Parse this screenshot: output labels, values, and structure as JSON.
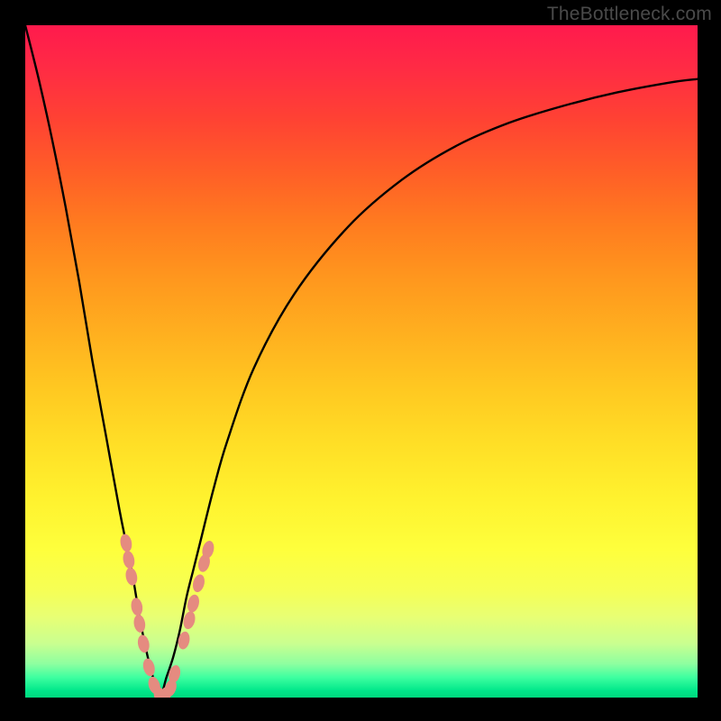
{
  "watermark": "TheBottleneck.com",
  "colors": {
    "frame": "#000000",
    "curve": "#000000",
    "marker_fill": "#e58b80",
    "marker_stroke": "#d97e73"
  },
  "chart_data": {
    "type": "line",
    "title": "",
    "xlabel": "",
    "ylabel": "",
    "xlim": [
      0,
      100
    ],
    "ylim": [
      0,
      100
    ],
    "note": "V-shaped bottleneck curve; y≈0 at the optimal match point, rising steeply toward 100 on either side. x and y are percentages.",
    "optimal_x": 20,
    "series": [
      {
        "name": "bottleneck-curve",
        "x": [
          0,
          2,
          4,
          6,
          8,
          10,
          12,
          14,
          15,
          16,
          17,
          18,
          19,
          20,
          21,
          22,
          23,
          24,
          25,
          26,
          28,
          30,
          34,
          40,
          48,
          56,
          64,
          72,
          80,
          88,
          96,
          100
        ],
        "y": [
          100,
          92,
          83,
          73,
          62,
          50,
          39,
          28,
          23,
          18,
          12,
          7,
          3,
          0,
          3,
          6,
          10,
          15,
          19,
          23,
          31,
          38,
          49,
          60,
          70,
          77,
          82,
          85.5,
          88,
          90,
          91.5,
          92
        ]
      }
    ],
    "markers": {
      "name": "highlighted-points",
      "note": "Pale-red rounded markers clustered near the V trough on both branches.",
      "points": [
        {
          "x": 15.0,
          "y": 23.0
        },
        {
          "x": 15.4,
          "y": 20.5
        },
        {
          "x": 15.8,
          "y": 18.0
        },
        {
          "x": 16.6,
          "y": 13.5
        },
        {
          "x": 17.0,
          "y": 11.0
        },
        {
          "x": 17.6,
          "y": 8.0
        },
        {
          "x": 18.4,
          "y": 4.5
        },
        {
          "x": 19.2,
          "y": 1.8
        },
        {
          "x": 20.0,
          "y": 0.3
        },
        {
          "x": 20.8,
          "y": 0.3
        },
        {
          "x": 21.6,
          "y": 1.4
        },
        {
          "x": 22.2,
          "y": 3.5
        },
        {
          "x": 23.6,
          "y": 8.5
        },
        {
          "x": 24.4,
          "y": 11.5
        },
        {
          "x": 25.0,
          "y": 14.0
        },
        {
          "x": 25.8,
          "y": 17.0
        },
        {
          "x": 26.6,
          "y": 20.0
        },
        {
          "x": 27.2,
          "y": 22.0
        }
      ]
    }
  }
}
